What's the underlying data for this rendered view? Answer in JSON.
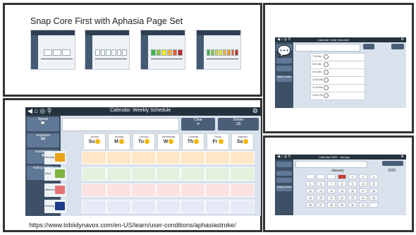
{
  "slide": {
    "title": "Snap Core First with Aphasia Page Set",
    "url": "https://www.tobiidynavox.com/en-US/learn/user-conditions/aphasiastroke/"
  },
  "weekly": {
    "title": "Calendar: Weekly Schedule",
    "speak_label": "Speak",
    "clear_label": "Clear",
    "delete_label": "Delete",
    "sidebar": [
      {
        "label": "Keyboard"
      },
      {
        "label": "Dashboard"
      },
      {
        "label": "Rating Scales"
      }
    ],
    "days": [
      {
        "name": "Sunday",
        "abbr": "Su"
      },
      {
        "name": "Monday",
        "abbr": "M"
      },
      {
        "name": "Tuesday",
        "abbr": "Tu"
      },
      {
        "name": "Wednesday",
        "abbr": "W"
      },
      {
        "name": "Thursday",
        "abbr": "Th"
      },
      {
        "name": "Friday",
        "abbr": "Fr"
      },
      {
        "name": "Saturday",
        "abbr": "Sa"
      }
    ],
    "rows": [
      {
        "label": "Morning",
        "color": "#fde7c7"
      },
      {
        "label": "Noon",
        "color": "#e3f2df"
      },
      {
        "label": "Afternoon",
        "color": "#fbe1e1"
      },
      {
        "label": "Evening",
        "color": "#e6eaf6"
      }
    ]
  },
  "daily": {
    "title": "Calendar: Daily Schedule",
    "sidebar": [
      {
        "label": "Rating Scales"
      }
    ],
    "times": [
      "7:00 AM",
      "8:00 AM",
      "9:00 AM",
      "10:00 AM",
      "11:00 AM",
      "12:00 PM"
    ]
  },
  "monthly": {
    "title": "Calendar 2020 - January",
    "month": "January",
    "year": "2020",
    "sidebar": [
      {
        "label": "Rating Scales"
      }
    ],
    "weeks": [
      [
        "",
        "",
        "",
        "1",
        "2",
        "3",
        "4"
      ],
      [
        "5",
        "6",
        "7",
        "8",
        "9",
        "10",
        "11"
      ],
      [
        "12",
        "13",
        "14",
        "15",
        "16",
        "17",
        "18"
      ],
      [
        "19",
        "20",
        "21",
        "22",
        "23",
        "24",
        "25"
      ],
      [
        "26",
        "27",
        "28",
        "29",
        "30",
        "31",
        ""
      ]
    ]
  },
  "colors": {
    "toolbar": "#24313f",
    "sidebar": "#3d5066",
    "accent": "#f2b705",
    "highlight": "#c9302c"
  }
}
